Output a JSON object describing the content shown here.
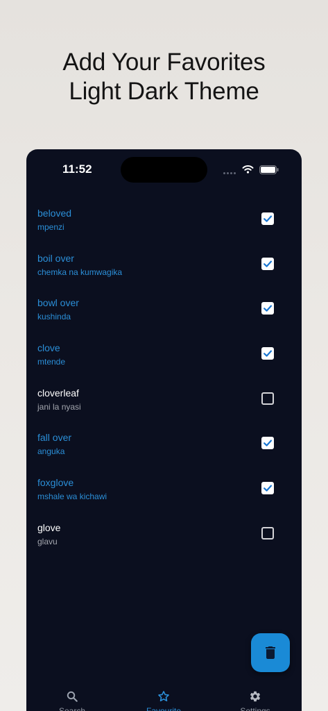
{
  "headline": {
    "line1": "Add Your Favorites",
    "line2": "Light Dark Theme"
  },
  "status_bar": {
    "time": "11:52",
    "icons": [
      "signal-dots-icon",
      "wifi-icon",
      "battery-icon"
    ]
  },
  "favorites": [
    {
      "word": "beloved",
      "translation": "mpenzi",
      "checked": true
    },
    {
      "word": "boil over",
      "translation": "chemka na kumwagika",
      "checked": true
    },
    {
      "word": "bowl over",
      "translation": "kushinda",
      "checked": true
    },
    {
      "word": "clove",
      "translation": "mtende",
      "checked": true
    },
    {
      "word": "cloverleaf",
      "translation": "jani la nyasi",
      "checked": false
    },
    {
      "word": "fall over",
      "translation": "anguka",
      "checked": true
    },
    {
      "word": "foxglove",
      "translation": "mshale wa kichawi",
      "checked": true
    },
    {
      "word": "glove",
      "translation": "glavu",
      "checked": false
    }
  ],
  "fab": {
    "icon": "trash-icon"
  },
  "tab_bar": {
    "tabs": [
      {
        "label": "Search",
        "icon": "search-icon",
        "active": false
      },
      {
        "label": "Favourite",
        "icon": "star-icon",
        "active": true
      },
      {
        "label": "Settings",
        "icon": "gear-icon",
        "active": false
      }
    ]
  },
  "colors": {
    "page_background": "#ebe8e4",
    "app_background": "#0b0f1f",
    "accent": "#2b8fd8",
    "fab": "#1a8ad6",
    "text_primary": "#ffffff",
    "text_secondary": "#a3a6ae",
    "headline": "#141414"
  }
}
